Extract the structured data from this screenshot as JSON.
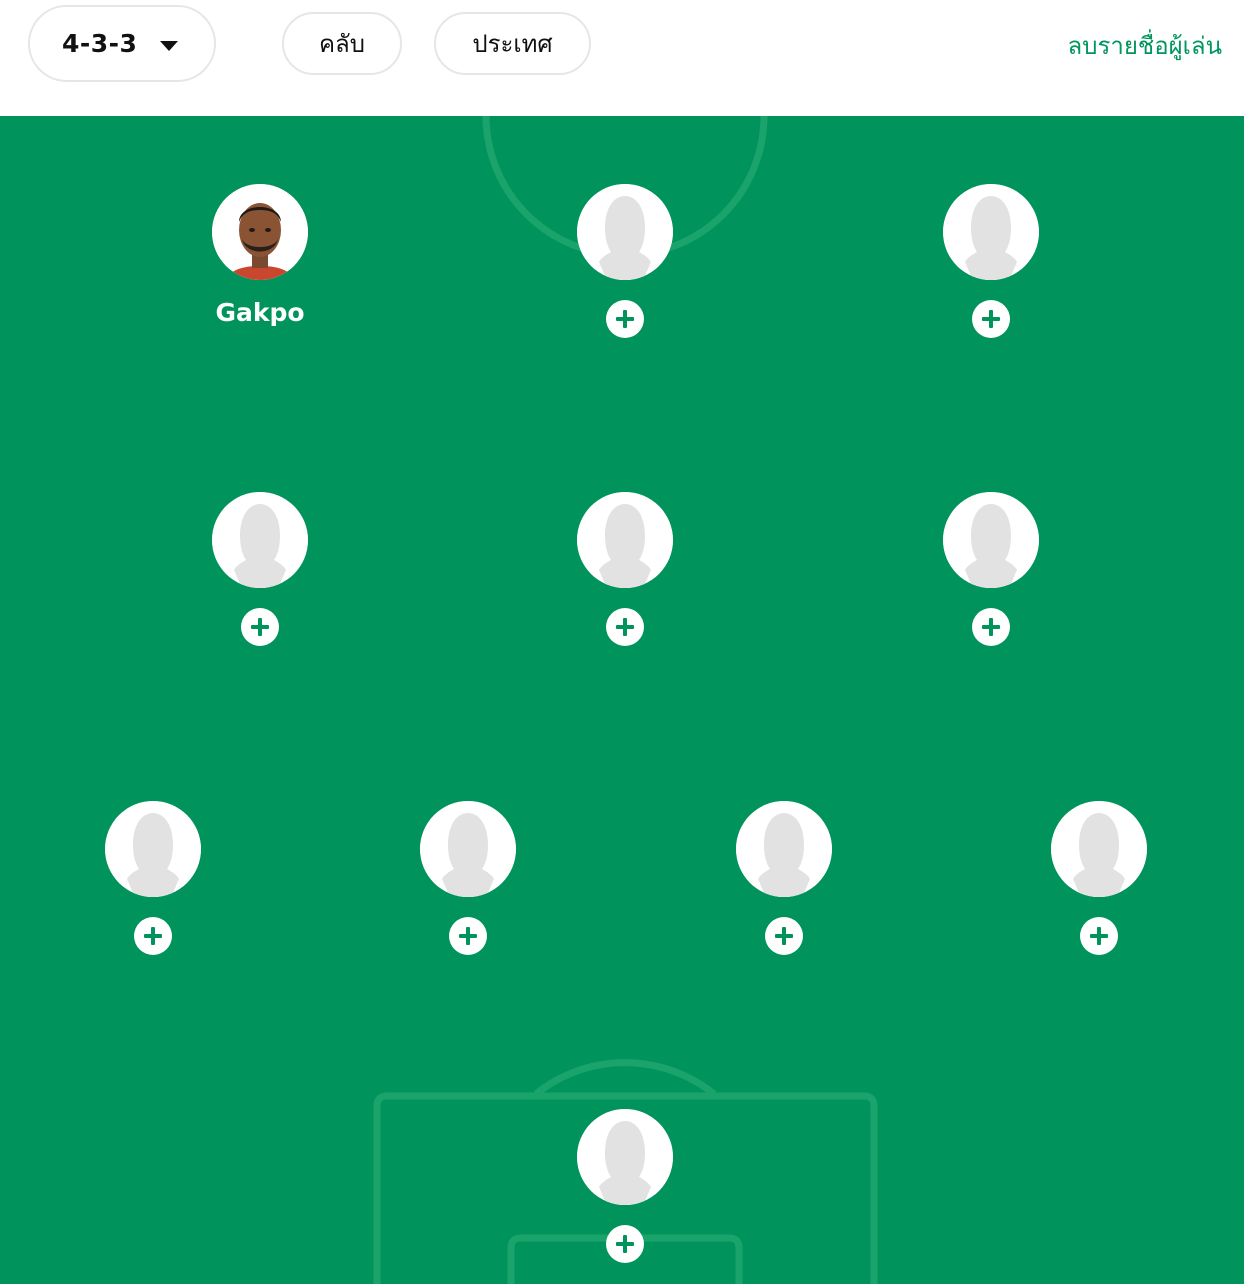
{
  "toolbar": {
    "formation": "4-3-3",
    "filters": [
      "คลับ",
      "ประเทศ"
    ],
    "clear_label": "ลบรายชื่อผู้เล่น"
  },
  "pitch": {
    "colors": {
      "grass": "#00945c",
      "lines": "#1aa46c",
      "accent": "#00965e"
    },
    "forwards": [
      {
        "name": "Gakpo",
        "photo": "player-photo",
        "add_icon": null
      },
      {
        "name": null,
        "photo": "silhouette-icon",
        "add_icon": "plus-icon"
      },
      {
        "name": null,
        "photo": "silhouette-icon",
        "add_icon": "plus-icon"
      }
    ],
    "midfielders": [
      {
        "name": null,
        "photo": "silhouette-icon",
        "add_icon": "plus-icon"
      },
      {
        "name": null,
        "photo": "silhouette-icon",
        "add_icon": "plus-icon"
      },
      {
        "name": null,
        "photo": "silhouette-icon",
        "add_icon": "plus-icon"
      }
    ],
    "defenders": [
      {
        "name": null,
        "photo": "silhouette-icon",
        "add_icon": "plus-icon"
      },
      {
        "name": null,
        "photo": "silhouette-icon",
        "add_icon": "plus-icon"
      },
      {
        "name": null,
        "photo": "silhouette-icon",
        "add_icon": "plus-icon"
      },
      {
        "name": null,
        "photo": "silhouette-icon",
        "add_icon": "plus-icon"
      }
    ],
    "goalkeeper": [
      {
        "name": null,
        "photo": "silhouette-icon",
        "add_icon": "plus-icon"
      }
    ]
  }
}
